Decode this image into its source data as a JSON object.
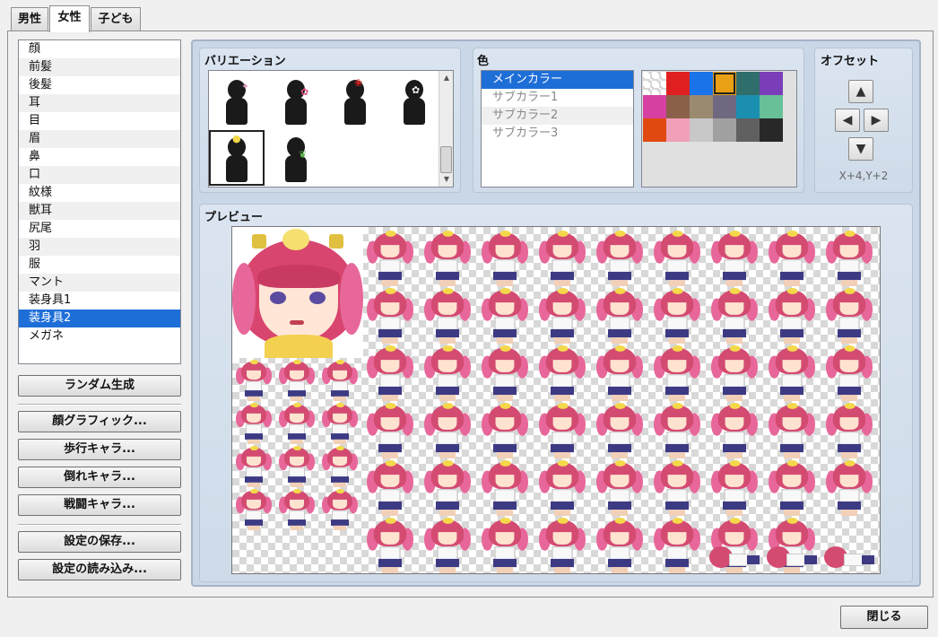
{
  "tabs": [
    {
      "label": "男性"
    },
    {
      "label": "女性"
    },
    {
      "label": "子ども"
    }
  ],
  "parts": {
    "items": [
      "顔",
      "前髪",
      "後髪",
      "耳",
      "目",
      "眉",
      "鼻",
      "口",
      "紋様",
      "獣耳",
      "尻尾",
      "羽",
      "服",
      "マント",
      "装身具1",
      "装身具2",
      "メガネ"
    ],
    "selected_index": 15
  },
  "buttons": {
    "random": "ランダム生成",
    "face_graphic": "顔グラフィック...",
    "walk_chara": "歩行キャラ...",
    "down_chara": "倒れキャラ...",
    "battle_chara": "戦闘キャラ...",
    "save_settings": "設定の保存...",
    "load_settings": "設定の読み込み...",
    "close": "閉じる"
  },
  "variation": {
    "title": "バリエーション",
    "selected_index": 4
  },
  "color": {
    "title": "色",
    "items": [
      "メインカラー",
      "サブカラー1",
      "サブカラー2",
      "サブカラー3"
    ],
    "selected_index": 0,
    "palette": [
      "checker",
      "#e02020",
      "#1a73e8",
      "#e9a015",
      "#2f6e6a",
      "#7a3fb8",
      "#d640a0",
      "#8a6048",
      "#9a8a70",
      "#706880",
      "#1a8fb0",
      "#68c098",
      "#e04a10",
      "#f0a0b8",
      "#c8c8c8",
      "#a0a0a0",
      "#606060",
      "#282828"
    ],
    "selected_swatch": 3
  },
  "offset": {
    "title": "オフセット",
    "up_icon": "▲",
    "left_icon": "◀",
    "right_icon": "▶",
    "down_icon": "▼",
    "readout": "X+4,Y+2"
  },
  "preview": {
    "title": "プレビュー"
  }
}
